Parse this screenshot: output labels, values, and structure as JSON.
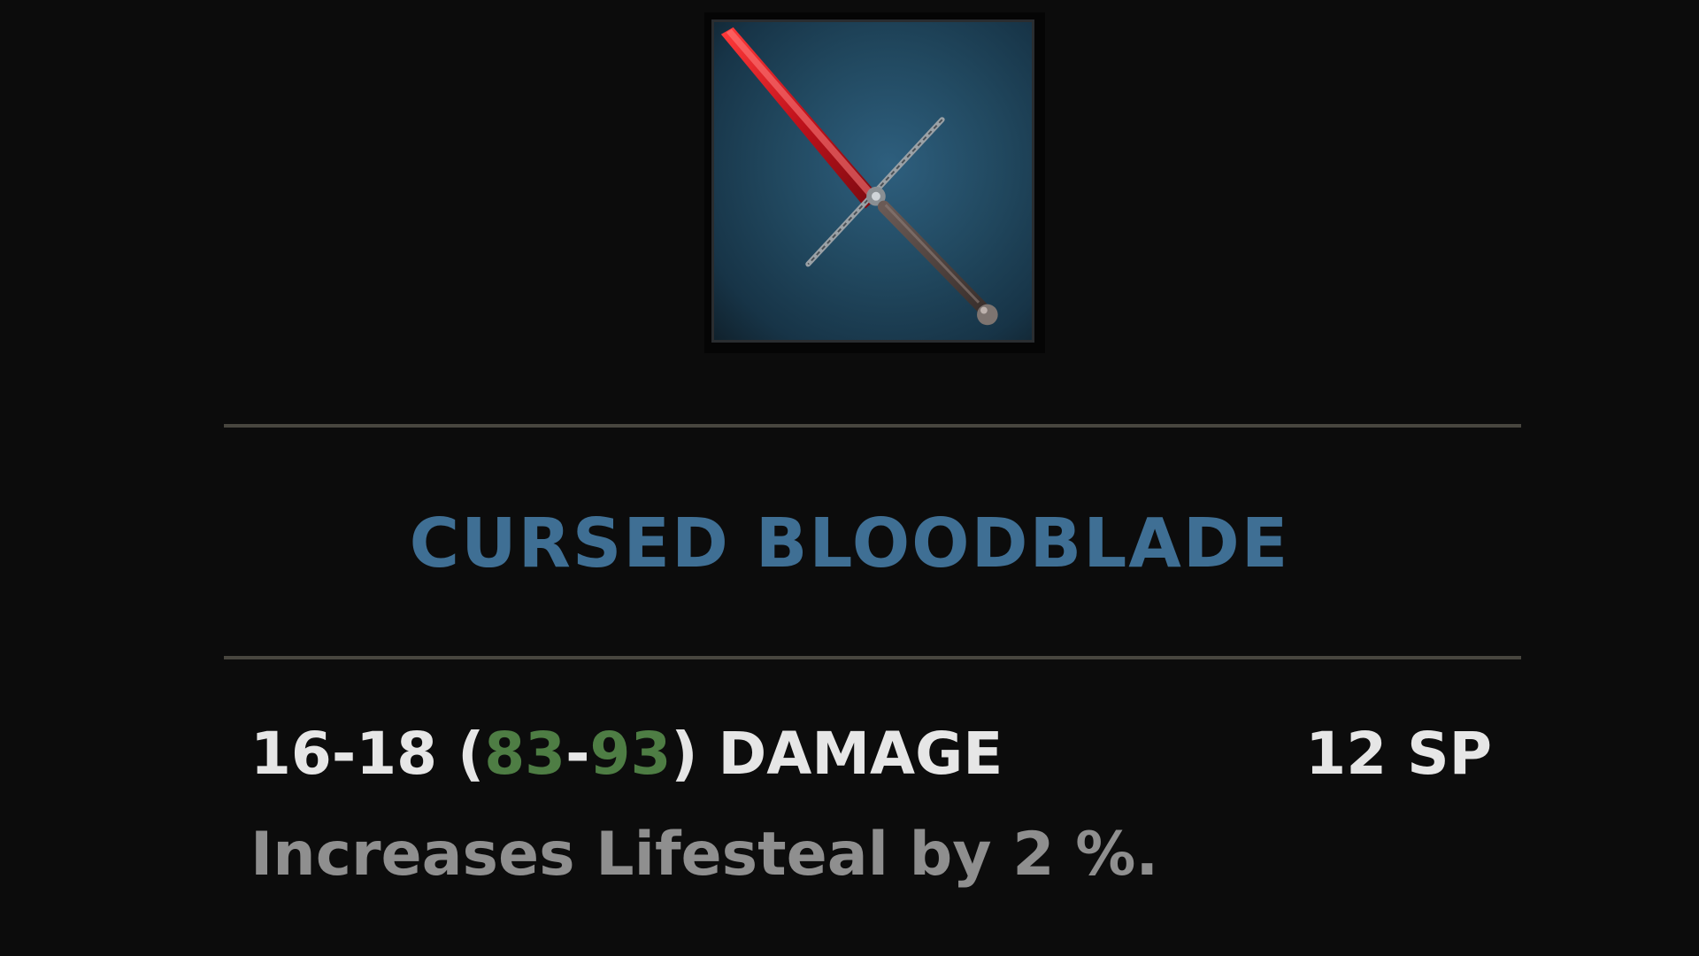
{
  "item": {
    "icon": "sword-icon",
    "name": "CURSED BLOODBLADE",
    "damage": {
      "base": "16-18",
      "open_paren": " (",
      "bonus_min": "83",
      "dash": "-",
      "bonus_max": "93",
      "close": ") DAMAGE"
    },
    "sp_cost": "12 SP",
    "description": "Increases Lifesteal by 2 %."
  },
  "colors": {
    "background": "#0c0c0c",
    "name": "#3f6f94",
    "stat_text": "#e6e6e6",
    "bonus": "#4e7d44",
    "description": "#8f8f8f",
    "divider": "#48463f",
    "blade": "#c1121c"
  }
}
